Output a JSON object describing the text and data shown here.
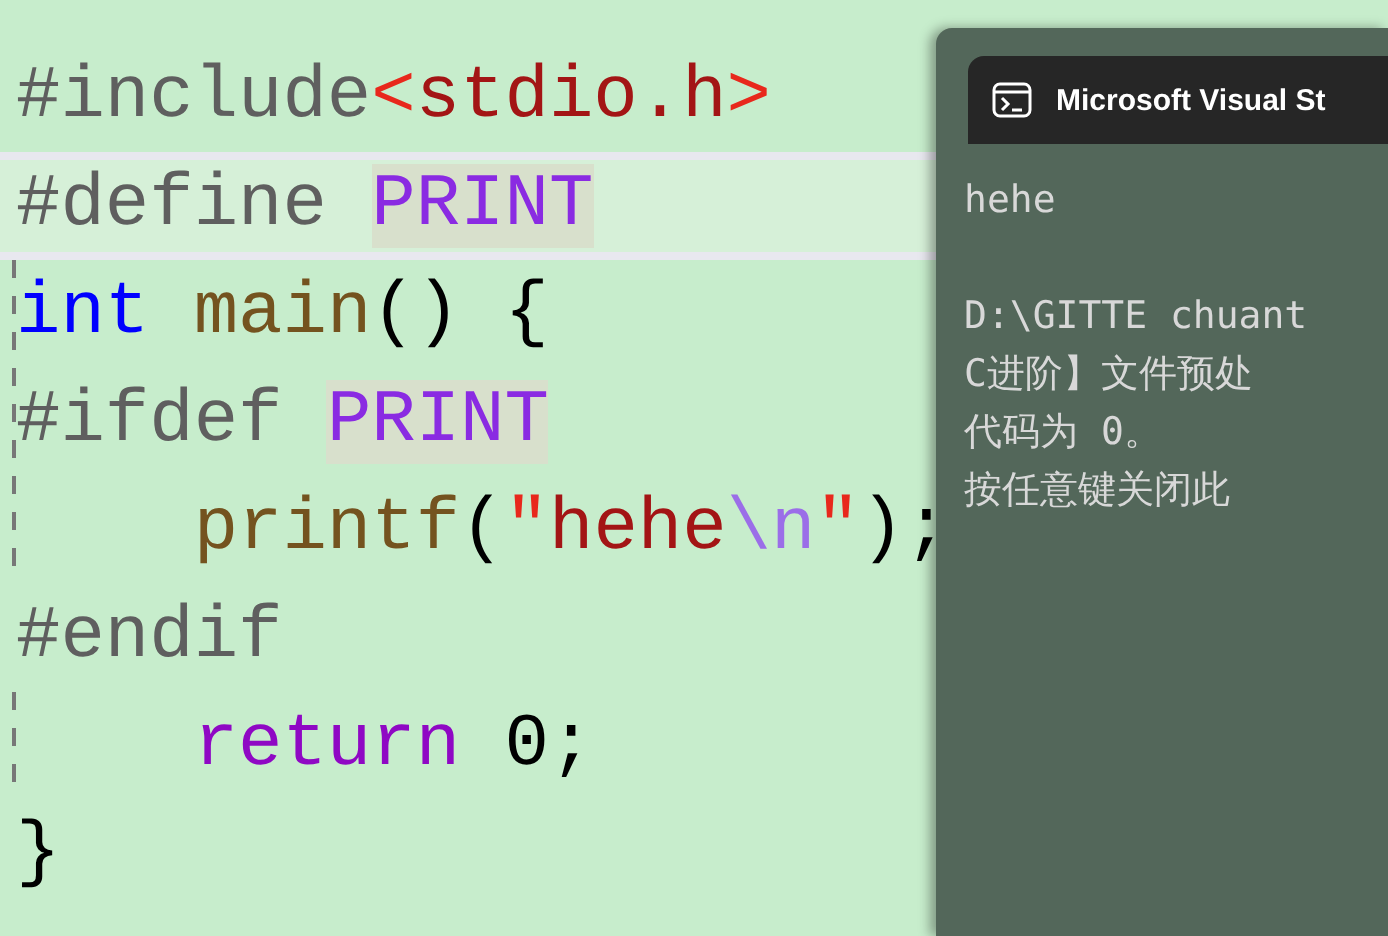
{
  "editor": {
    "lines": [
      {
        "current": false,
        "guide": false,
        "tokens": [
          {
            "kind": "preproc",
            "text": "#include"
          },
          {
            "kind": "bracket",
            "text": "<"
          },
          {
            "kind": "path",
            "text": "stdio.h"
          },
          {
            "kind": "bracket",
            "text": ">"
          }
        ]
      },
      {
        "current": true,
        "guide": false,
        "tokens": [
          {
            "kind": "preproc",
            "text": "#define "
          },
          {
            "kind": "macro",
            "text": "PRINT",
            "highlighted": true
          }
        ]
      },
      {
        "current": false,
        "guide": true,
        "tokens": [
          {
            "kind": "type",
            "text": "int "
          },
          {
            "kind": "function",
            "text": "main"
          },
          {
            "kind": "punct",
            "text": "() {"
          }
        ]
      },
      {
        "current": false,
        "guide": true,
        "tokens": [
          {
            "kind": "preproc",
            "text": "#ifdef "
          },
          {
            "kind": "macro",
            "text": "PRINT",
            "highlighted": true
          }
        ]
      },
      {
        "current": false,
        "guide": true,
        "tokens": [
          {
            "kind": "function",
            "text": "    printf"
          },
          {
            "kind": "punct",
            "text": "("
          },
          {
            "kind": "bracket",
            "text": "\""
          },
          {
            "kind": "path",
            "text": "hehe"
          },
          {
            "kind": "escape",
            "text": "\\n"
          },
          {
            "kind": "bracket",
            "text": "\""
          },
          {
            "kind": "punct",
            "text": ");"
          }
        ]
      },
      {
        "current": false,
        "guide": false,
        "tokens": [
          {
            "kind": "preproc",
            "text": "#endif"
          }
        ]
      },
      {
        "current": false,
        "guide": true,
        "tokens": [
          {
            "kind": "control",
            "text": "    return "
          },
          {
            "kind": "punct",
            "text": "0;"
          }
        ]
      },
      {
        "current": false,
        "guide": false,
        "tokens": [
          {
            "kind": "punct",
            "text": "}"
          }
        ]
      }
    ]
  },
  "console": {
    "title": "Microsoft Visual St",
    "output": [
      {
        "kind": "text",
        "text": "hehe"
      },
      {
        "kind": "blank"
      },
      {
        "kind": "text",
        "text": "D:\\GITTE chuant"
      },
      {
        "kind": "text",
        "text": "C进阶】文件预处"
      },
      {
        "kind": "text",
        "text": "代码为 0。"
      },
      {
        "kind": "text",
        "text": "按任意键关闭此"
      }
    ]
  }
}
